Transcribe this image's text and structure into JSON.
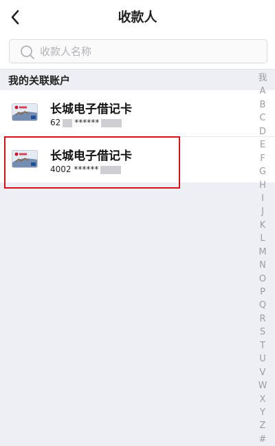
{
  "header": {
    "title": "收款人",
    "back_icon": "chevron-left-icon"
  },
  "search": {
    "placeholder": "收款人名称",
    "value": "",
    "icon": "search-icon"
  },
  "section": {
    "title": "我的关联账户"
  },
  "accounts": [
    {
      "name": "长城电子借记卡",
      "number_prefix": "62",
      "number_stars": "******",
      "icon": "bank-card-icon"
    },
    {
      "name": "长城电子借记卡",
      "number_prefix": "4002",
      "number_stars": "******",
      "icon": "bank-card-icon"
    }
  ],
  "index_letters": [
    "我",
    "A",
    "B",
    "C",
    "D",
    "E",
    "F",
    "G",
    "H",
    "I",
    "J",
    "K",
    "L",
    "M",
    "N",
    "O",
    "P",
    "Q",
    "R",
    "S",
    "T",
    "U",
    "V",
    "W",
    "X",
    "Y",
    "Z",
    "#"
  ],
  "colors": {
    "highlight": "#d4111b",
    "background": "#eeeff4",
    "index_text": "#9c9da3"
  }
}
